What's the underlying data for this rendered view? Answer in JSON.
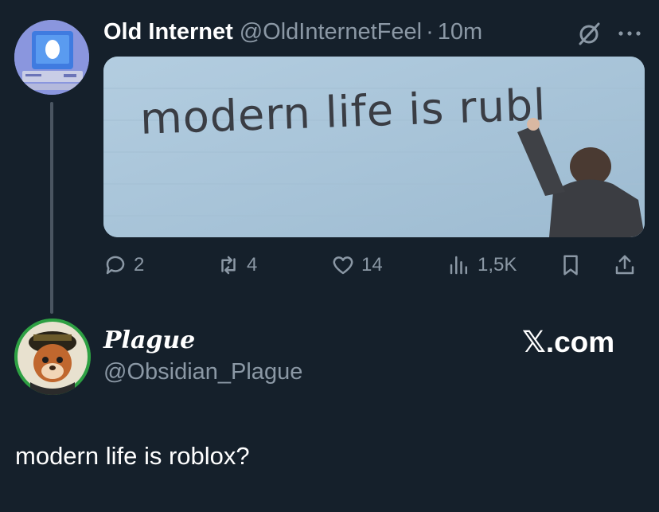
{
  "tweet": {
    "author_name": "Old Internet",
    "author_handle": "@OldInternetFeel",
    "separator": "·",
    "time": "10m",
    "image_text": "modern life is rubl",
    "stats": {
      "replies": "2",
      "retweets": "4",
      "likes": "14",
      "views": "1,5K"
    },
    "avatar_icon": "retro-computer-egg-icon"
  },
  "reply": {
    "author_name": "Plague",
    "author_handle": "@Obsidian_Plague",
    "text": "modern life is roblox?",
    "avatar_icon": "cartoon-character-avatar"
  },
  "watermark": {
    "x_glyph": "𝕏",
    "suffix": ".com"
  },
  "colors": {
    "background": "#15202b",
    "secondary_text": "#8b98a5",
    "thread_line": "#4a5561",
    "avatar1_bg": "#8a96de",
    "avatar2_ring": "#2ea043"
  }
}
